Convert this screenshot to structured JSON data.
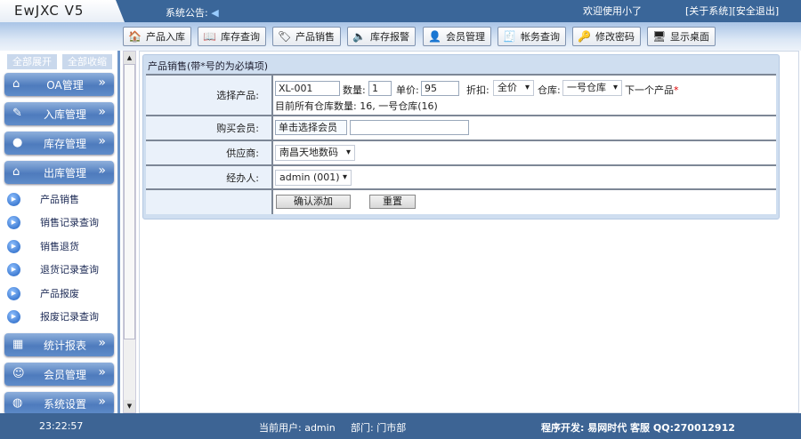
{
  "header": {
    "logo": "EwJXC V5",
    "notice_label": "系统公告:",
    "welcome": "欢迎使用小了",
    "about": "[关于系统]",
    "logout": "[安全退出]"
  },
  "toolbar": [
    {
      "label": "产品入库",
      "icon": "house-icon",
      "glyph": "🏠"
    },
    {
      "label": "库存查询",
      "icon": "book-icon",
      "glyph": "📖"
    },
    {
      "label": "产品销售",
      "icon": "tag-icon",
      "glyph": "🏷"
    },
    {
      "label": "库存报警",
      "icon": "speaker-icon",
      "glyph": "🔈"
    },
    {
      "label": "会员管理",
      "icon": "member-icon",
      "glyph": "👤"
    },
    {
      "label": "帐务查询",
      "icon": "account-icon",
      "glyph": "🧾"
    },
    {
      "label": "修改密码",
      "icon": "key-icon",
      "glyph": "🔑"
    },
    {
      "label": "显示桌面",
      "icon": "desktop-icon",
      "glyph": "🖥"
    }
  ],
  "sidebar": {
    "expand_all": "全部展开",
    "collapse_all": "全部收缩",
    "groups_top": [
      {
        "label": "OA管理",
        "glyph": "⌂"
      },
      {
        "label": "入库管理",
        "glyph": "✎"
      },
      {
        "label": "库存管理",
        "glyph": "●"
      },
      {
        "label": "出库管理",
        "glyph": "⌂"
      }
    ],
    "sub_items": [
      "产品销售",
      "销售记录查询",
      "销售退货",
      "退货记录查询",
      "产品报废",
      "报废记录查询"
    ],
    "groups_bottom": [
      {
        "label": "统计报表",
        "glyph": "▦"
      },
      {
        "label": "会员管理",
        "glyph": "☺"
      },
      {
        "label": "系统设置",
        "glyph": "◍"
      }
    ],
    "arrow": "»"
  },
  "form": {
    "title": "产品销售(带*号的为必填项)",
    "product_label": "选择产品:",
    "product_value": "XL-001",
    "qty_label": "数量:",
    "qty_value": "1",
    "price_label": "单价:",
    "price_value": "95",
    "discount_label": "折扣:",
    "discount_value": "全价",
    "warehouse_label": "仓库:",
    "warehouse_value": "一号仓库",
    "next_product": "下一个产品",
    "required": "*",
    "stock_info": "目前所有仓库数量: 16, 一号仓库(16)",
    "member_label": "购买会员:",
    "member_button": "单击选择会员",
    "member_value": "",
    "supplier_label": "供应商:",
    "supplier_value": "南昌天地数码",
    "handler_label": "经办人:",
    "handler_value": "admin (001)",
    "confirm": "确认添加",
    "reset": "重置"
  },
  "footer": {
    "time": "23:22:57",
    "user": "当前用户: admin",
    "dept": "部门: 门市部",
    "credit": "程序开发: 易网时代 客服 QQ:270012912"
  }
}
